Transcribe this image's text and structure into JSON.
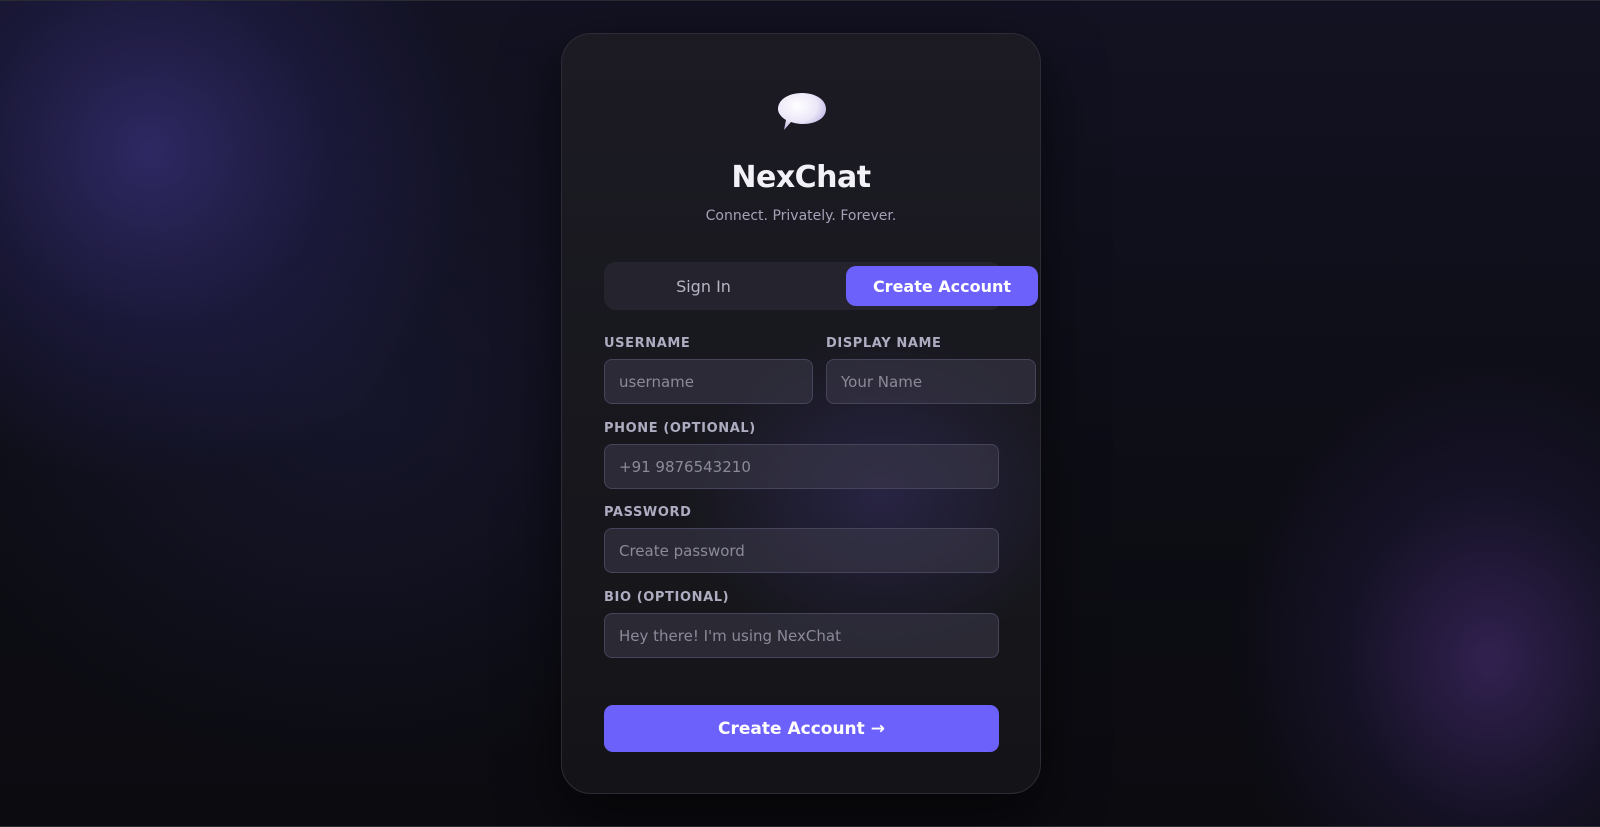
{
  "app": {
    "name": "NexChat",
    "tagline": "Connect. Privately. Forever.",
    "logo_icon": "speech-bubble-icon"
  },
  "tabs": [
    {
      "label": "Sign In",
      "active": false
    },
    {
      "label": "Create Account",
      "active": true
    }
  ],
  "form": {
    "username": {
      "label": "USERNAME",
      "value": "",
      "placeholder": "username"
    },
    "display_name": {
      "label": "DISPLAY NAME",
      "value": "",
      "placeholder": "Your Name"
    },
    "phone": {
      "label": "PHONE (OPTIONAL)",
      "value": "",
      "placeholder": "+91 9876543210"
    },
    "password": {
      "label": "PASSWORD",
      "value": "",
      "placeholder": "Create password"
    },
    "bio": {
      "label": "BIO (OPTIONAL)",
      "value": "",
      "placeholder": "Hey there! I'm using NexChat"
    },
    "submit_label": "Create Account →"
  },
  "colors": {
    "accent": "#6c61fb",
    "background": "#0c0c12",
    "card": "#1a1920"
  }
}
